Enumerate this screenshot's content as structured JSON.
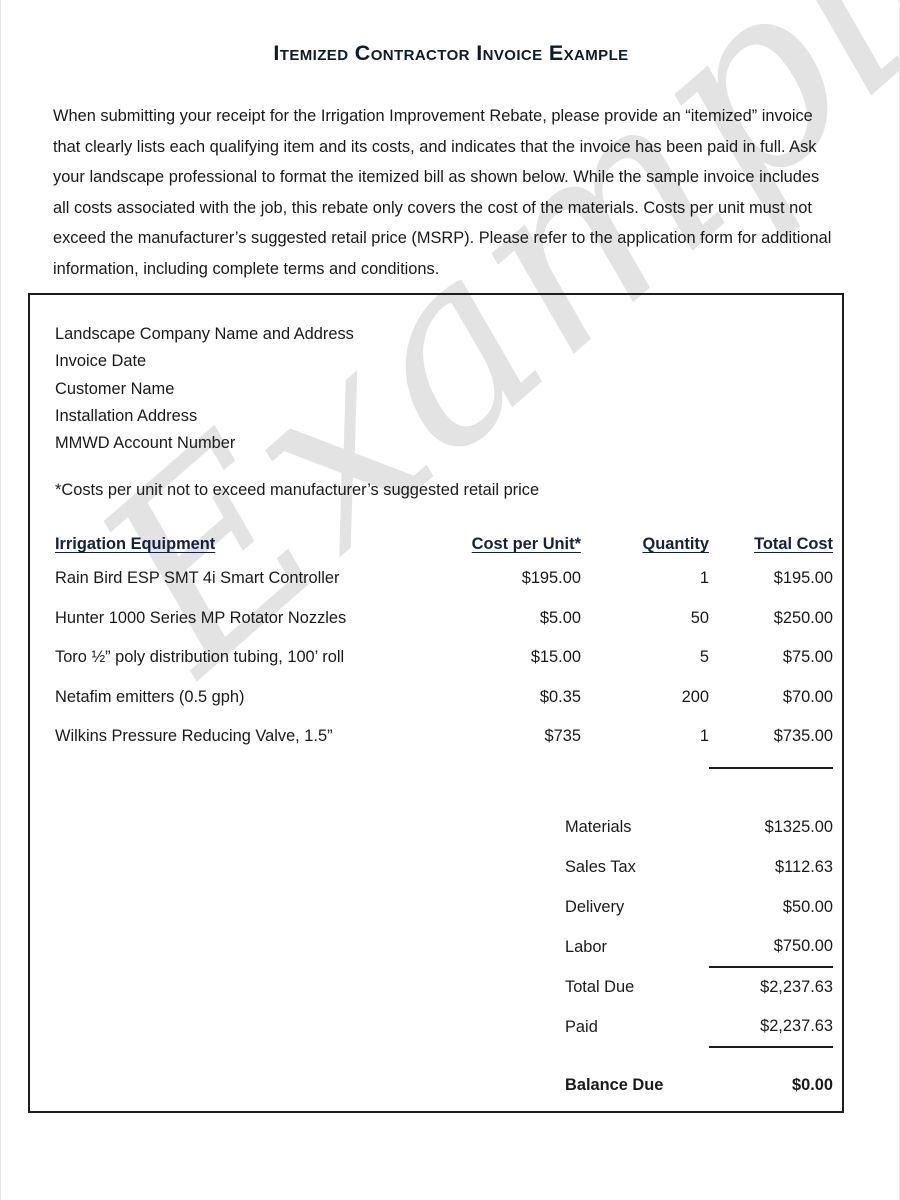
{
  "document": {
    "title": "Itemized Contractor Invoice Example",
    "watermark": "Example",
    "intro_paragraph": "When submitting your receipt for the Irrigation Improvement Rebate, please provide an “itemized” invoice that clearly lists each qualifying item and its costs, and indicates that the invoice has been paid in full. Ask your landscape professional to format the itemized bill as shown below. While the sample invoice includes all costs associated with the job, this rebate only covers the cost of the materials. Costs per unit must not exceed the manufacturer’s suggested retail price (MSRP). Please refer to the application form for additional information, including complete terms and conditions."
  },
  "invoice": {
    "header_lines": [
      "Landscape Company Name and Address",
      "Invoice Date",
      "Customer Name",
      "Installation Address",
      "MMWD Account Number"
    ],
    "msrp_note": "*Costs per unit not to exceed manufacturer’s suggested retail price",
    "table": {
      "columns": {
        "description": "Irrigation Equipment",
        "cost_per_unit": "Cost per Unit*",
        "quantity": "Quantity",
        "total_cost": "Total Cost"
      },
      "rows": [
        {
          "description": "Rain Bird ESP SMT 4i Smart Controller",
          "cost_per_unit": "$195.00",
          "quantity": "1",
          "total_cost": "$195.00"
        },
        {
          "description": "Hunter 1000 Series MP Rotator Nozzles",
          "cost_per_unit": "$5.00",
          "quantity": "50",
          "total_cost": "$250.00"
        },
        {
          "description": "Toro ½” poly distribution tubing, 100’ roll",
          "cost_per_unit": "$15.00",
          "quantity": "5",
          "total_cost": "$75.00"
        },
        {
          "description": "Netafim emitters (0.5 gph)",
          "cost_per_unit": "$0.35",
          "quantity": "200",
          "total_cost": "$70.00"
        },
        {
          "description": "Wilkins Pressure Reducing Valve, 1.5”",
          "cost_per_unit": "$735",
          "quantity": "1",
          "total_cost": "$735.00"
        }
      ]
    },
    "summary": [
      {
        "label": "Materials",
        "value": "$1325.00"
      },
      {
        "label": "Sales Tax",
        "value": "$112.63"
      },
      {
        "label": "Delivery",
        "value": "$50.00"
      },
      {
        "label": "Labor",
        "value": "$750.00"
      },
      {
        "label": "Total Due",
        "value": "$2,237.63"
      },
      {
        "label": "Paid",
        "value": "$2,237.63"
      },
      {
        "label": "Balance Due",
        "value": "$0.00"
      }
    ]
  },
  "colors": {
    "text": "#1a1a1a",
    "heading": "#14213d",
    "rule": "#1d1d1d",
    "watermark": "#e3e3e3",
    "box_border": "#1d1d1d"
  }
}
